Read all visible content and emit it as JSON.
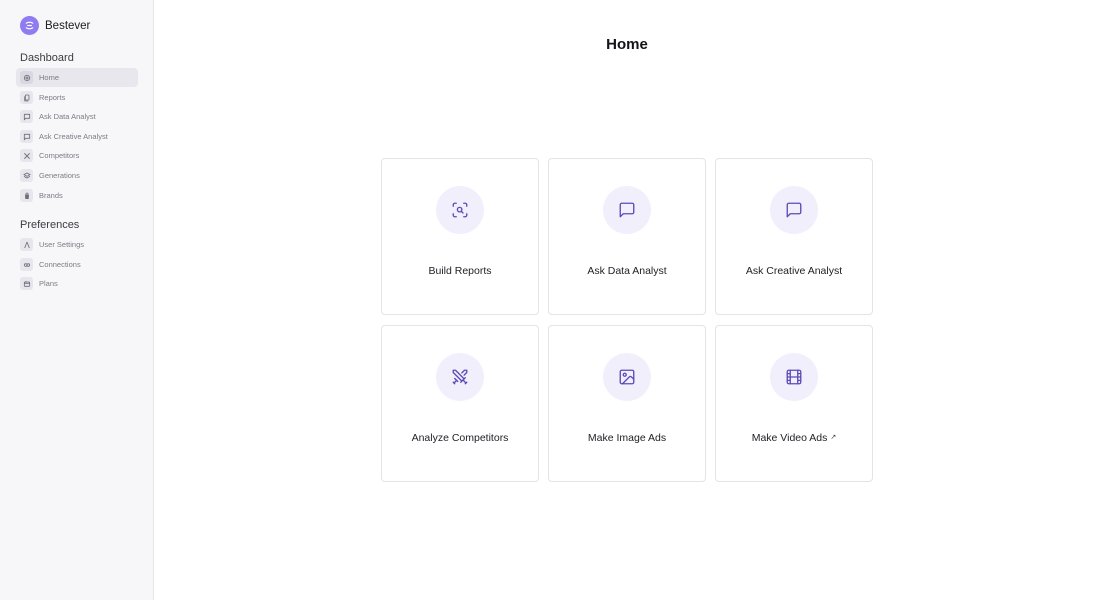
{
  "app": {
    "name": "Bestever",
    "accent": "#8e7cf0"
  },
  "sidebar": {
    "sections": [
      {
        "title": "Dashboard"
      },
      {
        "title": "Preferences"
      }
    ],
    "items": [
      {
        "label": "Home",
        "icon": "home-icon",
        "active": true
      },
      {
        "label": "Reports",
        "icon": "reports-icon"
      },
      {
        "label": "Ask Data Analyst",
        "icon": "chat-icon"
      },
      {
        "label": "Ask Creative Analyst",
        "icon": "chat-icon"
      },
      {
        "label": "Competitors",
        "icon": "swords-icon"
      },
      {
        "label": "Generations",
        "icon": "layers-icon"
      },
      {
        "label": "Brands",
        "icon": "bag-icon"
      },
      {
        "label": "User Settings",
        "icon": "user-icon"
      },
      {
        "label": "Connections",
        "icon": "link-icon"
      },
      {
        "label": "Plans",
        "icon": "plans-icon"
      }
    ]
  },
  "main": {
    "title": "Home",
    "cards": [
      {
        "label": "Build Reports",
        "icon": "scan-search-icon"
      },
      {
        "label": "Ask Data Analyst",
        "icon": "message-square-icon"
      },
      {
        "label": "Ask Creative Analyst",
        "icon": "message-square-icon"
      },
      {
        "label": "Analyze Competitors",
        "icon": "swords-icon"
      },
      {
        "label": "Make Image Ads",
        "icon": "image-icon"
      },
      {
        "label": "Make Video Ads",
        "icon": "film-icon",
        "external_mark": "↗"
      }
    ]
  }
}
